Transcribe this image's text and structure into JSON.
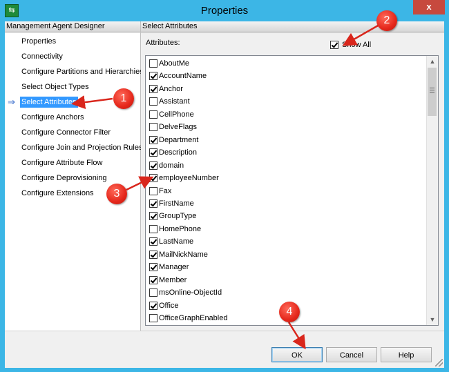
{
  "window": {
    "title": "Properties",
    "close_label": "x",
    "app_icon_glyph": "⇆"
  },
  "left_pane": {
    "header": "Management Agent Designer",
    "selected_arrow": "⇒",
    "items": [
      {
        "label": "Properties",
        "selected": false
      },
      {
        "label": "Connectivity",
        "selected": false
      },
      {
        "label": "Configure Partitions and Hierarchies",
        "selected": false
      },
      {
        "label": "Select Object Types",
        "selected": false
      },
      {
        "label": "Select Attributes",
        "selected": true
      },
      {
        "label": "Configure Anchors",
        "selected": false
      },
      {
        "label": "Configure Connector Filter",
        "selected": false
      },
      {
        "label": "Configure Join and Projection Rules",
        "selected": false
      },
      {
        "label": "Configure Attribute Flow",
        "selected": false
      },
      {
        "label": "Configure Deprovisioning",
        "selected": false
      },
      {
        "label": "Configure Extensions",
        "selected": false
      }
    ]
  },
  "right_pane": {
    "header": "Select Attributes",
    "attributes_label": "Attributes:",
    "show_all": {
      "label": "Show All",
      "checked": true
    },
    "attributes": [
      {
        "name": "AboutMe",
        "checked": false
      },
      {
        "name": "AccountName",
        "checked": true
      },
      {
        "name": "Anchor",
        "checked": true
      },
      {
        "name": "Assistant",
        "checked": false
      },
      {
        "name": "CellPhone",
        "checked": false
      },
      {
        "name": "DelveFlags",
        "checked": false
      },
      {
        "name": "Department",
        "checked": true
      },
      {
        "name": "Description",
        "checked": true
      },
      {
        "name": "domain",
        "checked": true
      },
      {
        "name": "employeeNumber",
        "checked": true
      },
      {
        "name": "Fax",
        "checked": false
      },
      {
        "name": "FirstName",
        "checked": true
      },
      {
        "name": "GroupType",
        "checked": true
      },
      {
        "name": "HomePhone",
        "checked": false
      },
      {
        "name": "LastName",
        "checked": true
      },
      {
        "name": "MailNickName",
        "checked": true
      },
      {
        "name": "Manager",
        "checked": true
      },
      {
        "name": "Member",
        "checked": true
      },
      {
        "name": "msOnline-ObjectId",
        "checked": false
      },
      {
        "name": "Office",
        "checked": true
      },
      {
        "name": "OfficeGraphEnabled",
        "checked": false
      }
    ]
  },
  "buttons": {
    "ok": "OK",
    "cancel": "Cancel",
    "help": "Help"
  },
  "callouts": [
    "1",
    "2",
    "3",
    "4"
  ],
  "colors": {
    "titlebar": "#3cb6e6",
    "selection": "#3399ff",
    "callout": "#e5271b"
  }
}
